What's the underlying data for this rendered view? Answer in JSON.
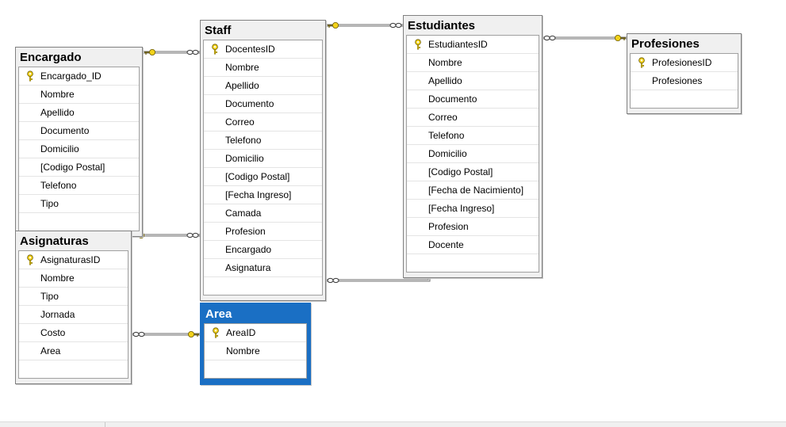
{
  "diagram": {
    "tables": [
      {
        "id": "encargado",
        "title": "Encargado",
        "columns": [
          "Encargado_ID",
          "Nombre",
          "Apellido",
          "Documento",
          "Domicilio",
          "[Codigo Postal]",
          "Telefono",
          "Tipo"
        ],
        "primary_key": "Encargado_ID"
      },
      {
        "id": "staff",
        "title": "Staff",
        "columns": [
          "DocentesID",
          "Nombre",
          "Apellido",
          "Documento",
          "Correo",
          "Telefono",
          "Domicilio",
          "[Codigo Postal]",
          "[Fecha Ingreso]",
          "Camada",
          "Profesion",
          "Encargado",
          "Asignatura"
        ],
        "primary_key": "DocentesID"
      },
      {
        "id": "estudiantes",
        "title": "Estudiantes",
        "columns": [
          "EstudiantesID",
          "Nombre",
          "Apellido",
          "Documento",
          "Correo",
          "Telefono",
          "Domicilio",
          "[Codigo Postal]",
          "[Fecha de Nacimiento]",
          "[Fecha Ingreso]",
          "Profesion",
          "Docente"
        ],
        "primary_key": "EstudiantesID"
      },
      {
        "id": "profesiones",
        "title": "Profesiones",
        "columns": [
          "ProfesionesID",
          "Profesiones"
        ],
        "primary_key": "ProfesionesID"
      },
      {
        "id": "asignaturas",
        "title": "Asignaturas",
        "columns": [
          "AsignaturasID",
          "Nombre",
          "Tipo",
          "Jornada",
          "Costo",
          "Area"
        ],
        "primary_key": "AsignaturasID"
      },
      {
        "id": "area",
        "title": "Area",
        "columns": [
          "AreaID",
          "Nombre"
        ],
        "primary_key": "AreaID",
        "selected": true
      }
    ],
    "relationships": [
      {
        "one": "encargado",
        "many": "staff"
      },
      {
        "one": "staff",
        "many": "estudiantes"
      },
      {
        "one": "profesiones",
        "many": "estudiantes"
      },
      {
        "one": "asignaturas",
        "many": "staff"
      },
      {
        "one": "area",
        "many": "asignaturas"
      },
      {
        "one": "estudiantes",
        "many": "staff"
      }
    ],
    "colors": {
      "selected_header": "#1a6fc4",
      "key_icon": "#f2d21b",
      "connector": "#6e6e6e"
    }
  }
}
